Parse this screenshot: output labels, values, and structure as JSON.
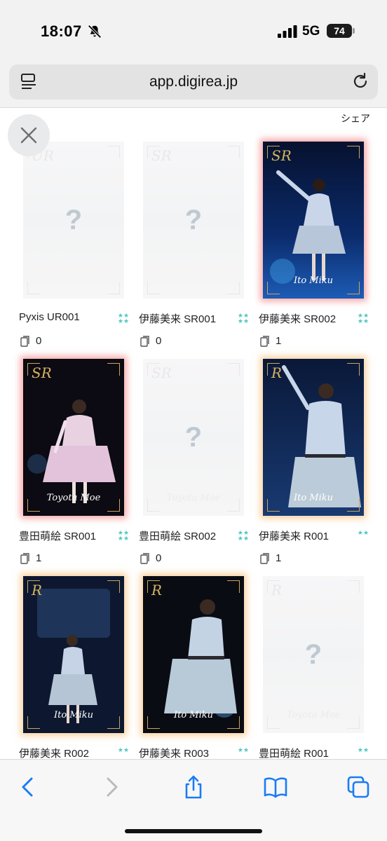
{
  "status_bar": {
    "time": "18:07",
    "network": "5G",
    "battery": "74"
  },
  "browser": {
    "url": "app.digirea.jp"
  },
  "page": {
    "share_label": "シェア"
  },
  "cards": [
    {
      "title": "Pyxis UR001",
      "count": "0",
      "rank": "UR",
      "nameplate": "",
      "owned": false,
      "stars": 2
    },
    {
      "title": "伊藤美来 SR001",
      "count": "0",
      "rank": "SR",
      "nameplate": "",
      "owned": false,
      "stars": 2
    },
    {
      "title": "伊藤美来 SR002",
      "count": "1",
      "rank": "SR",
      "nameplate": "Ito Miku",
      "owned": true,
      "glow": "red",
      "stars": 2
    },
    {
      "title": "豊田萌絵 SR001",
      "count": "1",
      "rank": "SR",
      "nameplate": "Toyota Moe",
      "owned": true,
      "glow": "red",
      "stars": 2
    },
    {
      "title": "豊田萌絵 SR002",
      "count": "0",
      "rank": "SR",
      "nameplate": "Toyota Moe",
      "owned": false,
      "stars": 2
    },
    {
      "title": "伊藤美来 R001",
      "count": "1",
      "rank": "R",
      "nameplate": "Ito Miku",
      "owned": true,
      "glow": "orange",
      "stars": 2
    },
    {
      "title": "伊藤美来 R002",
      "count": "",
      "rank": "R",
      "nameplate": "Ito Miku",
      "owned": true,
      "glow": "orange",
      "stars": 2
    },
    {
      "title": "伊藤美来 R003",
      "count": "",
      "rank": "R",
      "nameplate": "Ito Miku",
      "owned": true,
      "glow": "orange",
      "stars": 2
    },
    {
      "title": "豊田萌絵 R001",
      "count": "",
      "rank": "R",
      "nameplate": "Toyota Moe",
      "owned": false,
      "stars": 2
    }
  ],
  "toolbar": {
    "icons": [
      "back-icon",
      "forward-icon",
      "share-icon",
      "bookmarks-icon",
      "tabs-icon"
    ]
  },
  "colors": {
    "accent": "#4fc7c2",
    "glow_red": "#f06464",
    "glow_orange": "#f5af5a",
    "ios_blue": "#1a7cf5"
  }
}
